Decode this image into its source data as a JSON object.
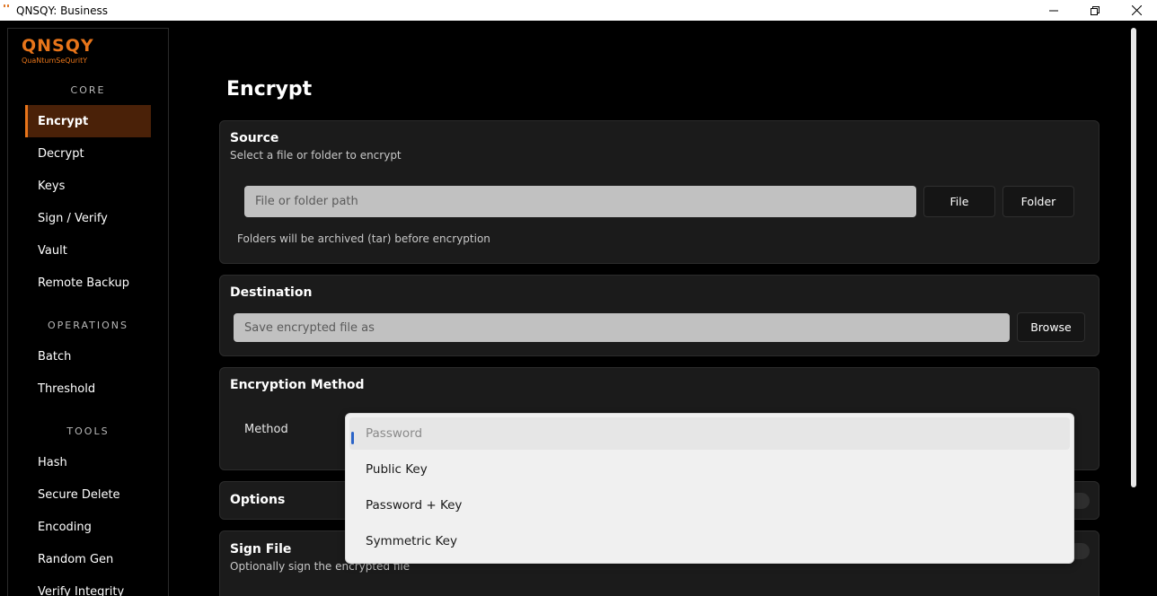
{
  "window": {
    "title": "QNSQY: Business",
    "controls": {
      "minimize": "minimize-icon",
      "maximize": "maximize-icon",
      "close": "close-icon"
    }
  },
  "brand": {
    "logo": "QNSQY",
    "tagline": "QuaNtumSeQuritY"
  },
  "sidebar": {
    "sections": [
      {
        "label": "CORE",
        "items": [
          "Encrypt",
          "Decrypt",
          "Keys",
          "Sign / Verify",
          "Vault",
          "Remote Backup"
        ]
      },
      {
        "label": "OPERATIONS",
        "items": [
          "Batch",
          "Threshold"
        ]
      },
      {
        "label": "TOOLS",
        "items": [
          "Hash",
          "Secure Delete",
          "Encoding",
          "Random Gen",
          "Verify Integrity"
        ]
      }
    ],
    "active": "Encrypt"
  },
  "page": {
    "title": "Encrypt"
  },
  "source": {
    "title": "Source",
    "subtitle": "Select a file or folder to encrypt",
    "placeholder": "File or folder path",
    "file_button": "File",
    "folder_button": "Folder",
    "note": "Folders will be archived (tar) before encryption"
  },
  "destination": {
    "title": "Destination",
    "placeholder": "Save encrypted file as",
    "browse_button": "Browse"
  },
  "encryption_method": {
    "title": "Encryption Method",
    "method_label": "Method",
    "options": [
      "Password",
      "Public Key",
      "Password + Key",
      "Symmetric Key"
    ],
    "selected": "Password"
  },
  "options": {
    "title": "Options"
  },
  "sign_file": {
    "title": "Sign File",
    "subtitle": "Optionally sign the encrypted file"
  },
  "colors": {
    "accent": "#e8751a",
    "active_bg": "#4a2108",
    "card_bg": "#1b1b1b",
    "selection_marker": "#2b64c8"
  }
}
